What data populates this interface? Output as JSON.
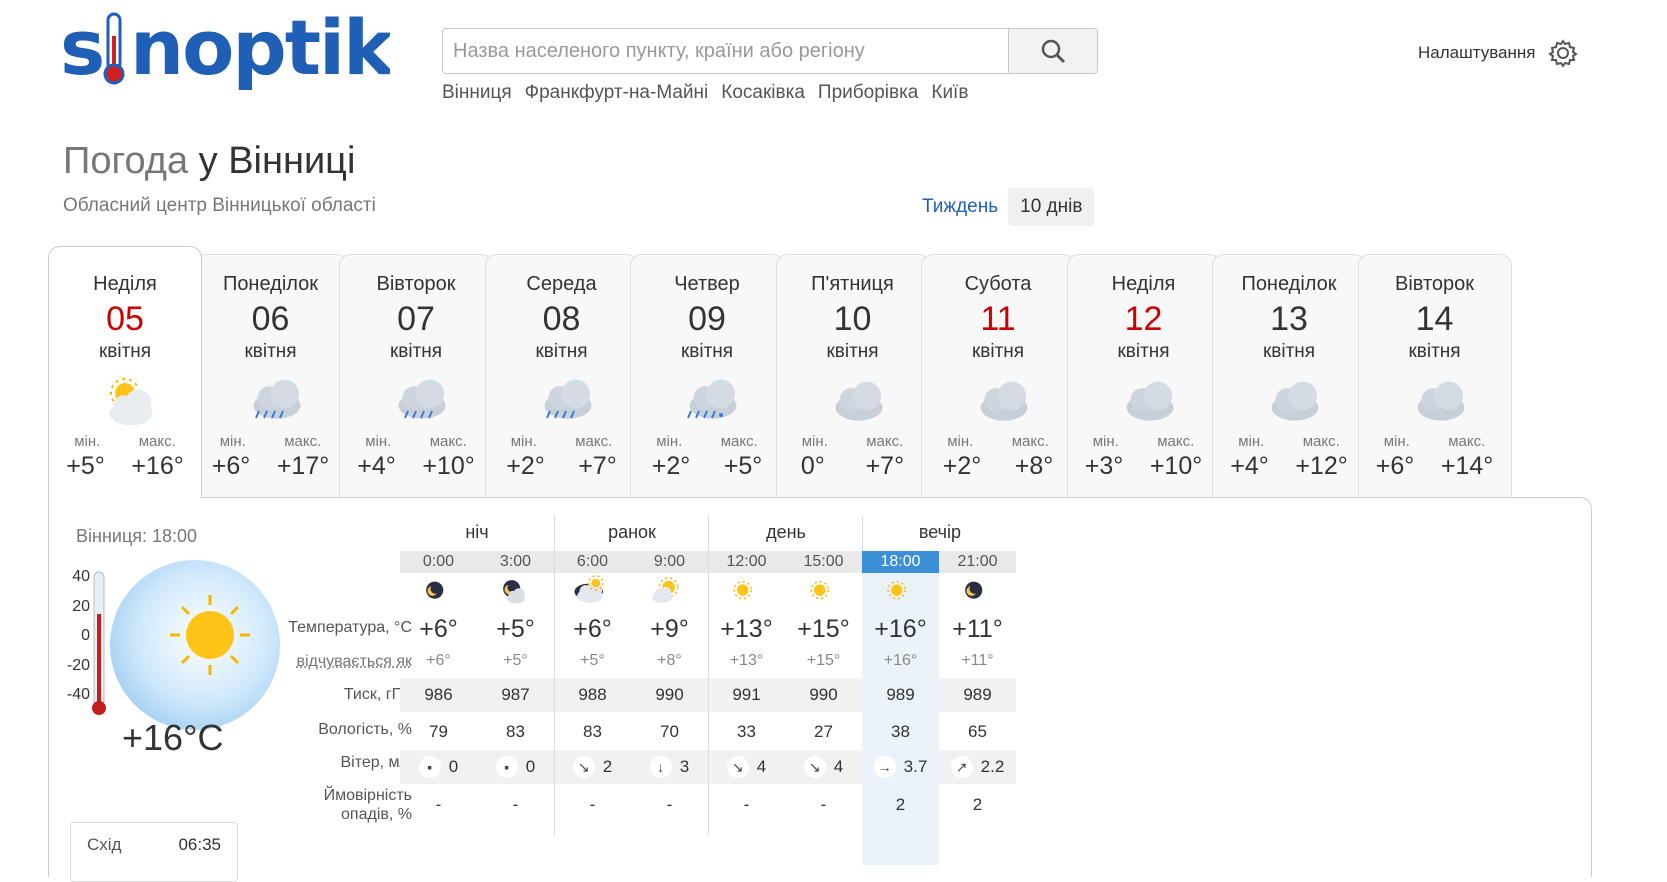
{
  "logo": {
    "text": "sinoptik"
  },
  "search": {
    "placeholder": "Назва населеного пункту, країни або регіону"
  },
  "recent": [
    "Вінниця",
    "Франкфурт-на-Майні",
    "Косаківка",
    "Приборівка",
    "Київ"
  ],
  "settings": {
    "label": "Налаштування"
  },
  "title": {
    "prefix": "Погода",
    "city": "у Вінниці"
  },
  "subtitle": "Обласний центр Вінницької області",
  "range": {
    "week": "Тиждень",
    "ten_days": "10 днів"
  },
  "days": [
    {
      "name": "Неділя",
      "date": "05",
      "month": "квітня",
      "min": "+5°",
      "max": "+16°",
      "icon": "partly-cloudy-sun",
      "weekend": true,
      "active": true
    },
    {
      "name": "Понеділок",
      "date": "06",
      "month": "квітня",
      "min": "+6°",
      "max": "+17°",
      "icon": "cloud-rain",
      "weekend": false,
      "active": false
    },
    {
      "name": "Вівторок",
      "date": "07",
      "month": "квітня",
      "min": "+4°",
      "max": "+10°",
      "icon": "cloud-light-rain",
      "weekend": false,
      "active": false
    },
    {
      "name": "Середа",
      "date": "08",
      "month": "квітня",
      "min": "+2°",
      "max": "+7°",
      "icon": "cloud-rain",
      "weekend": false,
      "active": false
    },
    {
      "name": "Четвер",
      "date": "09",
      "month": "квітня",
      "min": "+2°",
      "max": "+5°",
      "icon": "cloud-rain-snow",
      "weekend": false,
      "active": false
    },
    {
      "name": "П'ятниця",
      "date": "10",
      "month": "квітня",
      "min": "0°",
      "max": "+7°",
      "icon": "cloud",
      "weekend": false,
      "active": false
    },
    {
      "name": "Субота",
      "date": "11",
      "month": "квітня",
      "min": "+2°",
      "max": "+8°",
      "icon": "cloud",
      "weekend": true,
      "active": false
    },
    {
      "name": "Неділя",
      "date": "12",
      "month": "квітня",
      "min": "+3°",
      "max": "+10°",
      "icon": "cloud",
      "weekend": true,
      "active": false
    },
    {
      "name": "Понеділок",
      "date": "13",
      "month": "квітня",
      "min": "+4°",
      "max": "+12°",
      "icon": "cloud",
      "weekend": false,
      "active": false
    },
    {
      "name": "Вівторок",
      "date": "14",
      "month": "квітня",
      "min": "+6°",
      "max": "+14°",
      "icon": "cloud",
      "weekend": false,
      "active": false
    }
  ],
  "labels": {
    "min": "мін.",
    "max": "макс."
  },
  "now": {
    "location_time": "Вінниця: 18:00",
    "temp": "+16°C",
    "scale": [
      "40",
      "20",
      "0",
      "-20",
      "-40"
    ],
    "sunrise_label": "Схід",
    "sunrise": "06:35"
  },
  "hourly": {
    "periods": [
      "ніч",
      "ранок",
      "день",
      "вечір"
    ],
    "row_labels": {
      "temp": "Температура, °C",
      "feels": "відчувається як",
      "pressure": "Тиск, гПа",
      "humidity": "Вологість, %",
      "wind": "Вітер, м/с",
      "precip_1": "Ймовірність",
      "precip_2": "опадів, %"
    },
    "hours": [
      {
        "time": "0:00",
        "icon": "moon",
        "temp": "+6°",
        "feels": "+6°",
        "pressure": "986",
        "humidity": "79",
        "wind_dir": "calm",
        "wind": "0",
        "precip": "-",
        "current": false
      },
      {
        "time": "3:00",
        "icon": "moon-cloud",
        "temp": "+5°",
        "feels": "+5°",
        "pressure": "987",
        "humidity": "83",
        "wind_dir": "calm",
        "wind": "0",
        "precip": "-",
        "current": false
      },
      {
        "time": "6:00",
        "icon": "cloud-sun",
        "temp": "+6°",
        "feels": "+5°",
        "pressure": "988",
        "humidity": "83",
        "wind_dir": "se",
        "wind": "2",
        "precip": "-",
        "current": false
      },
      {
        "time": "9:00",
        "icon": "sun-cloud",
        "temp": "+9°",
        "feels": "+8°",
        "pressure": "990",
        "humidity": "70",
        "wind_dir": "s",
        "wind": "3",
        "precip": "-",
        "current": false
      },
      {
        "time": "12:00",
        "icon": "sun",
        "temp": "+13°",
        "feels": "+13°",
        "pressure": "991",
        "humidity": "33",
        "wind_dir": "se",
        "wind": "4",
        "precip": "-",
        "current": false
      },
      {
        "time": "15:00",
        "icon": "sun",
        "temp": "+15°",
        "feels": "+15°",
        "pressure": "990",
        "humidity": "27",
        "wind_dir": "se",
        "wind": "4",
        "precip": "-",
        "current": false
      },
      {
        "time": "18:00",
        "icon": "sun",
        "temp": "+16°",
        "feels": "+16°",
        "pressure": "989",
        "humidity": "38",
        "wind_dir": "e",
        "wind": "3.7",
        "precip": "2",
        "current": true
      },
      {
        "time": "21:00",
        "icon": "moon",
        "temp": "+11°",
        "feels": "+11°",
        "pressure": "989",
        "humidity": "65",
        "wind_dir": "ne",
        "wind": "2.2",
        "precip": "2",
        "current": false
      }
    ]
  },
  "colors": {
    "brand": "#1f5fb5",
    "weekend": "#cc0000",
    "current_hour": "#3b8fd6"
  }
}
